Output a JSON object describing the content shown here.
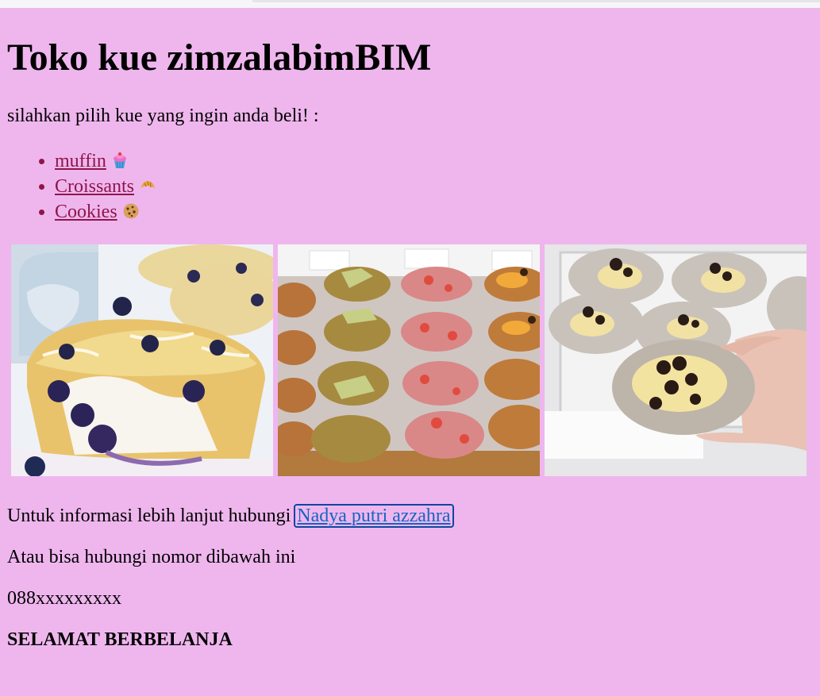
{
  "page": {
    "title": "Toko kue zimzalabimBIM",
    "intro": "silahkan pilih kue yang ingin anda beli! :",
    "menu": [
      {
        "label": "muffin",
        "icon": "cupcake-icon"
      },
      {
        "label": "Croissants",
        "icon": "croissant-icon"
      },
      {
        "label": "Cookies",
        "icon": "cookie-icon"
      }
    ],
    "gallery": [
      {
        "subject": "blueberry-muffin-photo"
      },
      {
        "subject": "croissants-photo"
      },
      {
        "subject": "cookies-photo"
      }
    ],
    "contact_text": "Untuk informasi lebih lanjut hubungi",
    "contact_link": "Nadya putri azzahra",
    "alt_text": "Atau bisa hubungi nomor dibawah ini",
    "phone": "088xxxxxxxxx",
    "closing": "SELAMAT BERBELANJA"
  },
  "colors": {
    "background": "#efb6ee",
    "list_link": "#8f1548",
    "contact_link": "#1565c0"
  }
}
